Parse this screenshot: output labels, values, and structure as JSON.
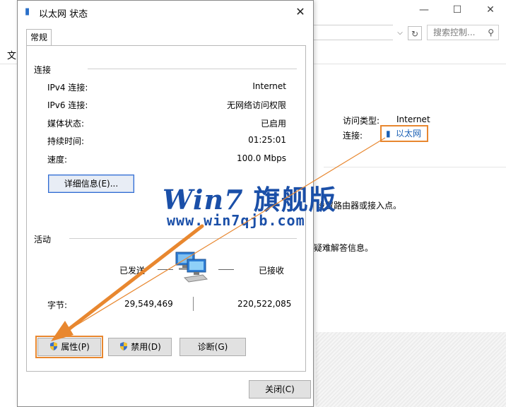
{
  "background_window": {
    "search_placeholder": "搜索控制...",
    "menu_fragment": "文",
    "access_type_label": "访问类型:",
    "access_type_value": "Internet",
    "connection_label": "连接:",
    "connection_link": "以太网",
    "text_router": "设置路由器或接入点。",
    "text_troubleshoot": "疑难解答信息。"
  },
  "watermark": {
    "title_latin": "Win7",
    "title_cn": "旗舰版",
    "url": "www.win7qjb.com"
  },
  "dialog": {
    "title": "以太网 状态",
    "tab_general": "常规",
    "connection_group": "连接",
    "rows": [
      {
        "label": "IPv4 连接:",
        "value": "Internet"
      },
      {
        "label": "IPv6 连接:",
        "value": "无网络访问权限"
      },
      {
        "label": "媒体状态:",
        "value": "已启用"
      },
      {
        "label": "持续时间:",
        "value": "01:25:01"
      },
      {
        "label": "速度:",
        "value": "100.0 Mbps"
      }
    ],
    "details_button": "详细信息(E)...",
    "activity_group": "活动",
    "sent_label": "已发送",
    "received_label": "已接收",
    "bytes_label": "字节:",
    "bytes_sent": "29,549,469",
    "bytes_received": "220,522,085",
    "properties_button": "属性(P)",
    "disable_button": "禁用(D)",
    "diagnose_button": "诊断(G)",
    "close_button": "关闭(C)"
  },
  "colors": {
    "highlight": "#e8872f",
    "link": "#1a5fb4",
    "watermark": "#1a4fa8"
  }
}
